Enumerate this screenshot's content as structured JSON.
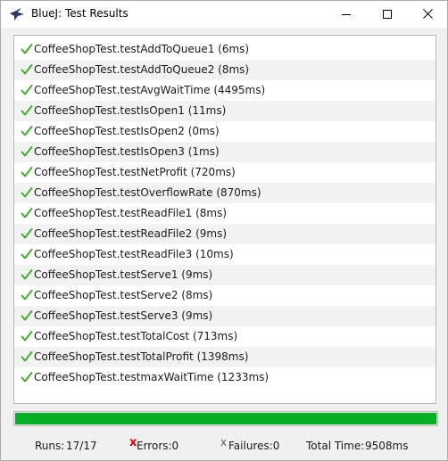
{
  "window": {
    "title": "BlueJ:  Test Results"
  },
  "tests": [
    {
      "label": "CoffeeShopTest.testAddToQueue1 (6ms)",
      "passed": true
    },
    {
      "label": "CoffeeShopTest.testAddToQueue2 (8ms)",
      "passed": true
    },
    {
      "label": "CoffeeShopTest.testAvgWaitTime (4495ms)",
      "passed": true
    },
    {
      "label": "CoffeeShopTest.testIsOpen1 (11ms)",
      "passed": true
    },
    {
      "label": "CoffeeShopTest.testIsOpen2 (0ms)",
      "passed": true
    },
    {
      "label": "CoffeeShopTest.testIsOpen3 (1ms)",
      "passed": true
    },
    {
      "label": "CoffeeShopTest.testNetProfit (720ms)",
      "passed": true
    },
    {
      "label": "CoffeeShopTest.testOverflowRate (870ms)",
      "passed": true
    },
    {
      "label": "CoffeeShopTest.testReadFile1 (8ms)",
      "passed": true
    },
    {
      "label": "CoffeeShopTest.testReadFile2 (9ms)",
      "passed": true
    },
    {
      "label": "CoffeeShopTest.testReadFile3 (10ms)",
      "passed": true
    },
    {
      "label": "CoffeeShopTest.testServe1 (9ms)",
      "passed": true
    },
    {
      "label": "CoffeeShopTest.testServe2 (8ms)",
      "passed": true
    },
    {
      "label": "CoffeeShopTest.testServe3 (9ms)",
      "passed": true
    },
    {
      "label": "CoffeeShopTest.testTotalCost (713ms)",
      "passed": true
    },
    {
      "label": "CoffeeShopTest.testTotalProfit (1398ms)",
      "passed": true
    },
    {
      "label": "CoffeeShopTest.testmaxWaitTime (1233ms)",
      "passed": true
    }
  ],
  "progress": {
    "fraction": 1.0,
    "color": "#06b025"
  },
  "status": {
    "runs_label": "Runs:",
    "runs_value": "17/17",
    "errors_icon": "x",
    "errors_label": "Errors:0",
    "failures_icon": "x",
    "failures_label": "Failures:0",
    "total_label": "Total Time:",
    "total_value": "9508ms"
  },
  "colors": {
    "pass_check": "#3fae2a",
    "error_icon": "#d40000",
    "progress_fill": "#06b025"
  },
  "icons": {
    "app": "bluej-bird-icon",
    "minimize": "minimize-icon",
    "maximize": "maximize-icon",
    "close": "close-icon",
    "pass": "check-icon"
  }
}
